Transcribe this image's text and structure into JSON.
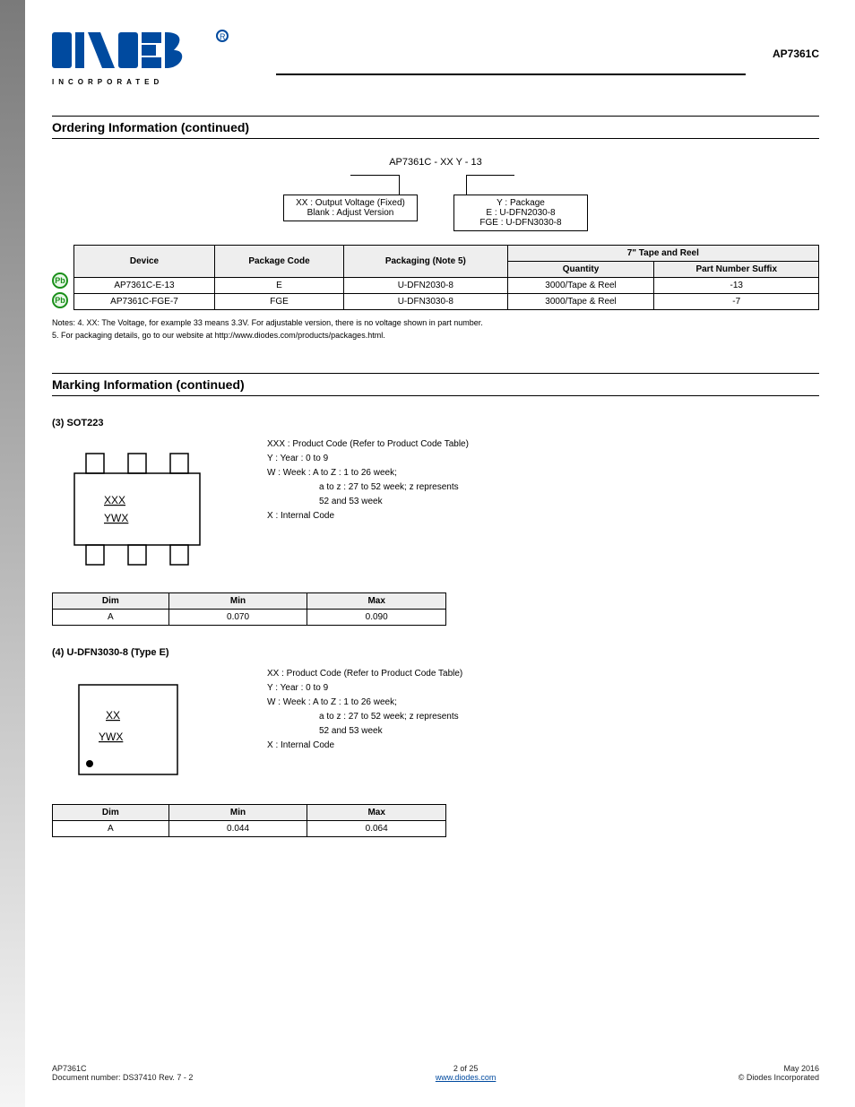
{
  "header": {
    "product": "AP7361C",
    "doc_line1": "Document number: DS37410 Rev. 7 - 2",
    "doc_line2_label": "AP7361C",
    "doc_line2_suffix": "2 of 25",
    "site": "www.diodes.com",
    "date": "May 2016",
    "copyright": "© Diodes Incorporated"
  },
  "ordering": {
    "title": "Ordering Information (continued)",
    "part_example": "AP7361C - XX Y - 13",
    "box_left": "XX : Output Voltage (Fixed)\nBlank : Adjust Version",
    "box_right": "Y : Package\nE : U-DFN2030-8\nFGE : U-DFN3030-8",
    "table": {
      "headers": [
        "Device",
        "Package Code",
        "Packaging (Note 5)",
        "7\" Tape and Reel"
      ],
      "subheaders": [
        "",
        "",
        "",
        "Quantity",
        "Part Number Suffix"
      ],
      "rows": [
        [
          "AP7361C-E-13",
          "E",
          "U-DFN2030-8",
          "3000/Tape & Reel",
          "-13"
        ],
        [
          "AP7361C-FGE-7",
          "FGE",
          "U-DFN3030-8",
          "3000/Tape & Reel",
          "-7"
        ]
      ]
    },
    "notes": [
      "Notes: 4. XX: The Voltage, for example 33 means 3.3V. For adjustable version, there is no voltage shown in part number.",
      "5. For packaging details, go to our website at http://www.diodes.com/products/packages.html."
    ]
  },
  "marking": {
    "title": "Marking Information (continued)",
    "sot223": {
      "name": "(3) SOT223",
      "lines": [
        "XXX",
        "YWX"
      ],
      "legend": [
        "XXX : Product Code (Refer to Product Code Table)",
        "Y : Year : 0 to 9",
        "W : Week : A to Z : 1 to 26 week;",
        "a to z : 27 to 52 week; z represents",
        "52 and 53 week",
        "X : Internal Code"
      ],
      "dims": {
        "headers": [
          "Dim",
          "Min",
          "Max"
        ],
        "row": [
          "A",
          "0.070",
          "0.090"
        ]
      }
    },
    "dfn3030": {
      "name": "(4) U-DFN3030-8 (Type E)",
      "lines": [
        "XX",
        "YWX"
      ],
      "legend": [
        "XX : Product Code (Refer to Product Code Table)",
        "Y : Year : 0 to 9",
        "W : Week : A to Z : 1 to 26 week;",
        "a to z : 27 to 52 week; z represents",
        "52 and 53 week",
        "X : Internal Code"
      ],
      "dims": {
        "headers": [
          "Dim",
          "Min",
          "Max"
        ],
        "row": [
          "A",
          "0.044",
          "0.064"
        ]
      }
    }
  }
}
